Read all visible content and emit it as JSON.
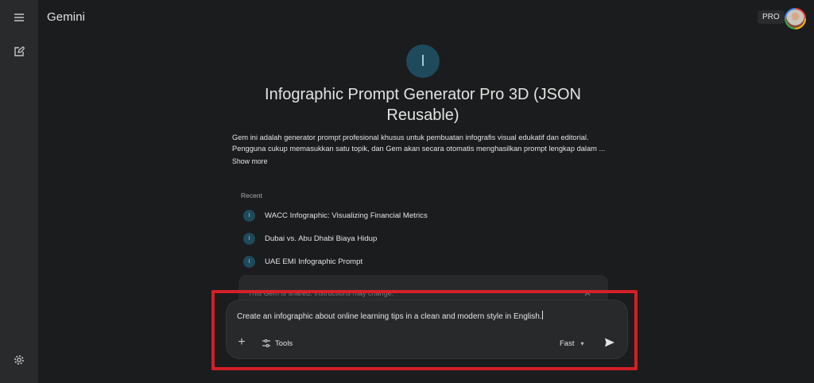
{
  "app": {
    "title": "Gemini",
    "plan_badge": "PRO"
  },
  "rail": {
    "menu_icon": "menu-icon",
    "new_chat_icon": "edit-icon",
    "settings_icon": "gear-icon"
  },
  "gem": {
    "initial": "I",
    "title": "Infographic Prompt Generator Pro 3D (JSON Reusable)",
    "description_line1": "Gem ini adalah generator prompt profesional khusus untuk pembuatan infografis visual edukatif dan editorial.",
    "description_line2": "Pengguna cukup memasukkan satu topik, dan Gem akan secara otomatis menghasilkan prompt lengkap dalam ...",
    "show_more": "Show more",
    "accent_color": "#1e4a5c"
  },
  "recent": {
    "label": "Recent",
    "items": [
      {
        "initial": "I",
        "label": "WACC Infographic: Visualizing Financial Metrics"
      },
      {
        "initial": "I",
        "label": "Dubai vs. Abu Dhabi Biaya Hidup"
      },
      {
        "initial": "I",
        "label": "UAE EMI Infographic Prompt"
      }
    ]
  },
  "notice": {
    "text": "This Gem is shared. Instructions may change.",
    "close_icon": "close-icon"
  },
  "composer": {
    "prompt_value": "Create an infographic about online learning tips in a clean and modern style in English.",
    "add_icon": "plus-icon",
    "tools_label": "Tools",
    "tools_icon": "tools-icon",
    "model_label": "Fast",
    "model_icon": "chevron-down-icon",
    "send_icon": "send-icon"
  },
  "highlight_color": "#d32027"
}
